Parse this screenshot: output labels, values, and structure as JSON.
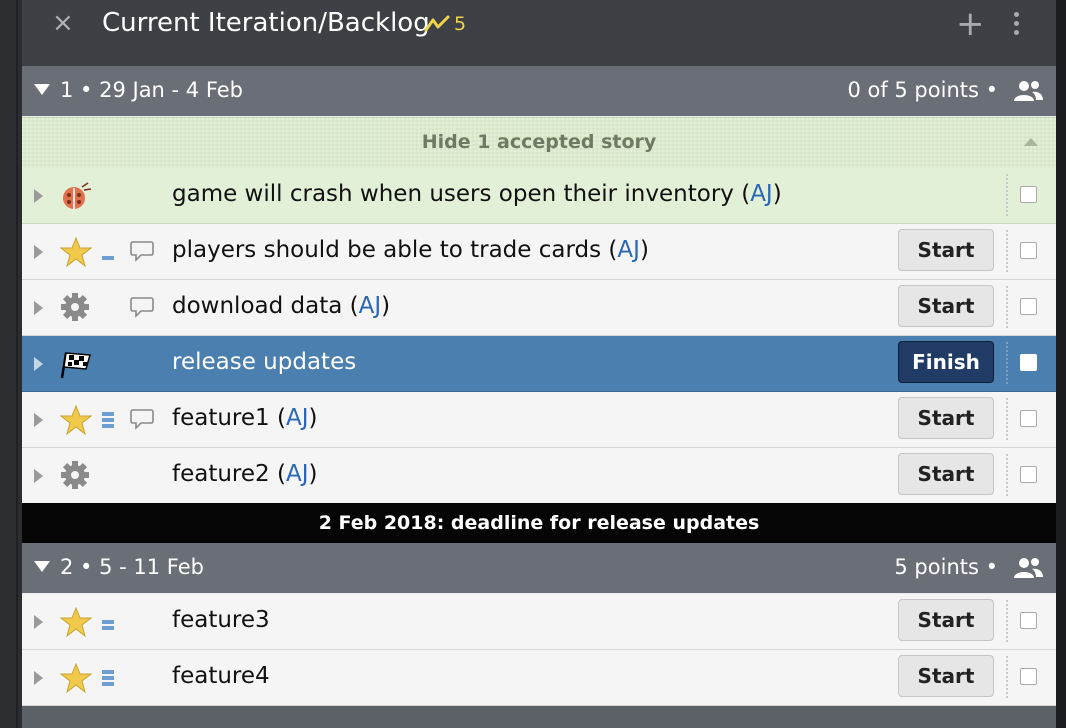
{
  "header": {
    "close_glyph": "×",
    "title": "Current Iteration/Backlog",
    "velocity": "5",
    "velocity_icon": "velocity-zigzag-icon",
    "add_glyph": "+"
  },
  "colors": {
    "header_bg": "#3d4045",
    "iteration_bg": "#6a6e76",
    "accepted_bg": "#e3f0d8",
    "selected_bg": "#4a7fb0",
    "owner_link": "#2a67b5",
    "velocity_accent": "#f0d34a",
    "finish_button": "#1f3b66"
  },
  "iterations": [
    {
      "label": "1 • 29 Jan - 4 Feb",
      "points": "0 of 5 points •",
      "accepted_toggle": "Hide 1 accepted story",
      "stories": [
        {
          "type": "bug",
          "estimate": 0,
          "comment": false,
          "name": "game will crash when users open their inventory",
          "owner": "AJ",
          "button": null,
          "state": "accepted"
        },
        {
          "type": "feature",
          "estimate": 1,
          "comment": true,
          "name": "players should be able to trade cards",
          "owner": "AJ",
          "button": "Start",
          "state": "unstarted"
        },
        {
          "type": "chore",
          "estimate": 0,
          "comment": true,
          "name": "download data",
          "owner": "AJ",
          "button": "Start",
          "state": "unstarted"
        },
        {
          "type": "release",
          "estimate": 0,
          "comment": false,
          "name": "release updates",
          "owner": null,
          "button": "Finish",
          "state": "selected"
        },
        {
          "type": "feature",
          "estimate": 3,
          "comment": true,
          "name": "feature1",
          "owner": "AJ",
          "button": "Start",
          "state": "unstarted"
        },
        {
          "type": "chore",
          "estimate": 0,
          "comment": false,
          "name": "feature2",
          "owner": "AJ",
          "button": "Start",
          "state": "unstarted"
        }
      ]
    },
    {
      "label": "2 • 5 - 11 Feb",
      "points": "5 points •",
      "stories": [
        {
          "type": "feature",
          "estimate": 2,
          "comment": false,
          "name": "feature3",
          "owner": null,
          "button": "Start",
          "state": "unstarted"
        },
        {
          "type": "feature",
          "estimate": 3,
          "comment": false,
          "name": "feature4",
          "owner": null,
          "button": "Start",
          "state": "unstarted"
        }
      ]
    }
  ],
  "deadline": "2 Feb 2018: deadline for release updates"
}
